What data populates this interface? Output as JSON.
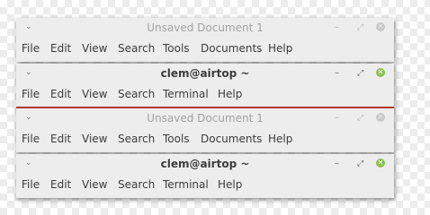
{
  "windows": [
    {
      "title": "Unsaved Document 1",
      "active": false,
      "controls": {
        "menu": "⌄",
        "minimize": "–",
        "maximize": "⤢",
        "close": "✕"
      },
      "menu": [
        "File",
        "Edit",
        "View",
        "Search",
        "Tools",
        "Documents",
        "Help"
      ]
    },
    {
      "title": "clem@airtop ~",
      "active": true,
      "controls": {
        "menu": "⌄",
        "minimize": "–",
        "maximize": "⤢",
        "close": "✕"
      },
      "menu": [
        "File",
        "Edit",
        "View",
        "Search",
        "Terminal",
        "Help"
      ]
    },
    {
      "title": "Unsaved Document 1",
      "active": false,
      "controls": {
        "menu": "⌄",
        "minimize": "–",
        "maximize": "⤢",
        "close": "✕"
      },
      "menu": [
        "File",
        "Edit",
        "View",
        "Search",
        "Tools",
        "Documents",
        "Help"
      ]
    },
    {
      "title": "clem@airtop ~",
      "active": true,
      "controls": {
        "menu": "⌄",
        "minimize": "–",
        "maximize": "⤢",
        "close": "✕"
      },
      "menu": [
        "File",
        "Edit",
        "View",
        "Search",
        "Terminal",
        "Help"
      ]
    }
  ],
  "colors": {
    "active_close": "#8cc152",
    "inactive_close": "#c8c8c8",
    "focus_underline": "#bf3b2b",
    "window_bg": "#ededed"
  }
}
